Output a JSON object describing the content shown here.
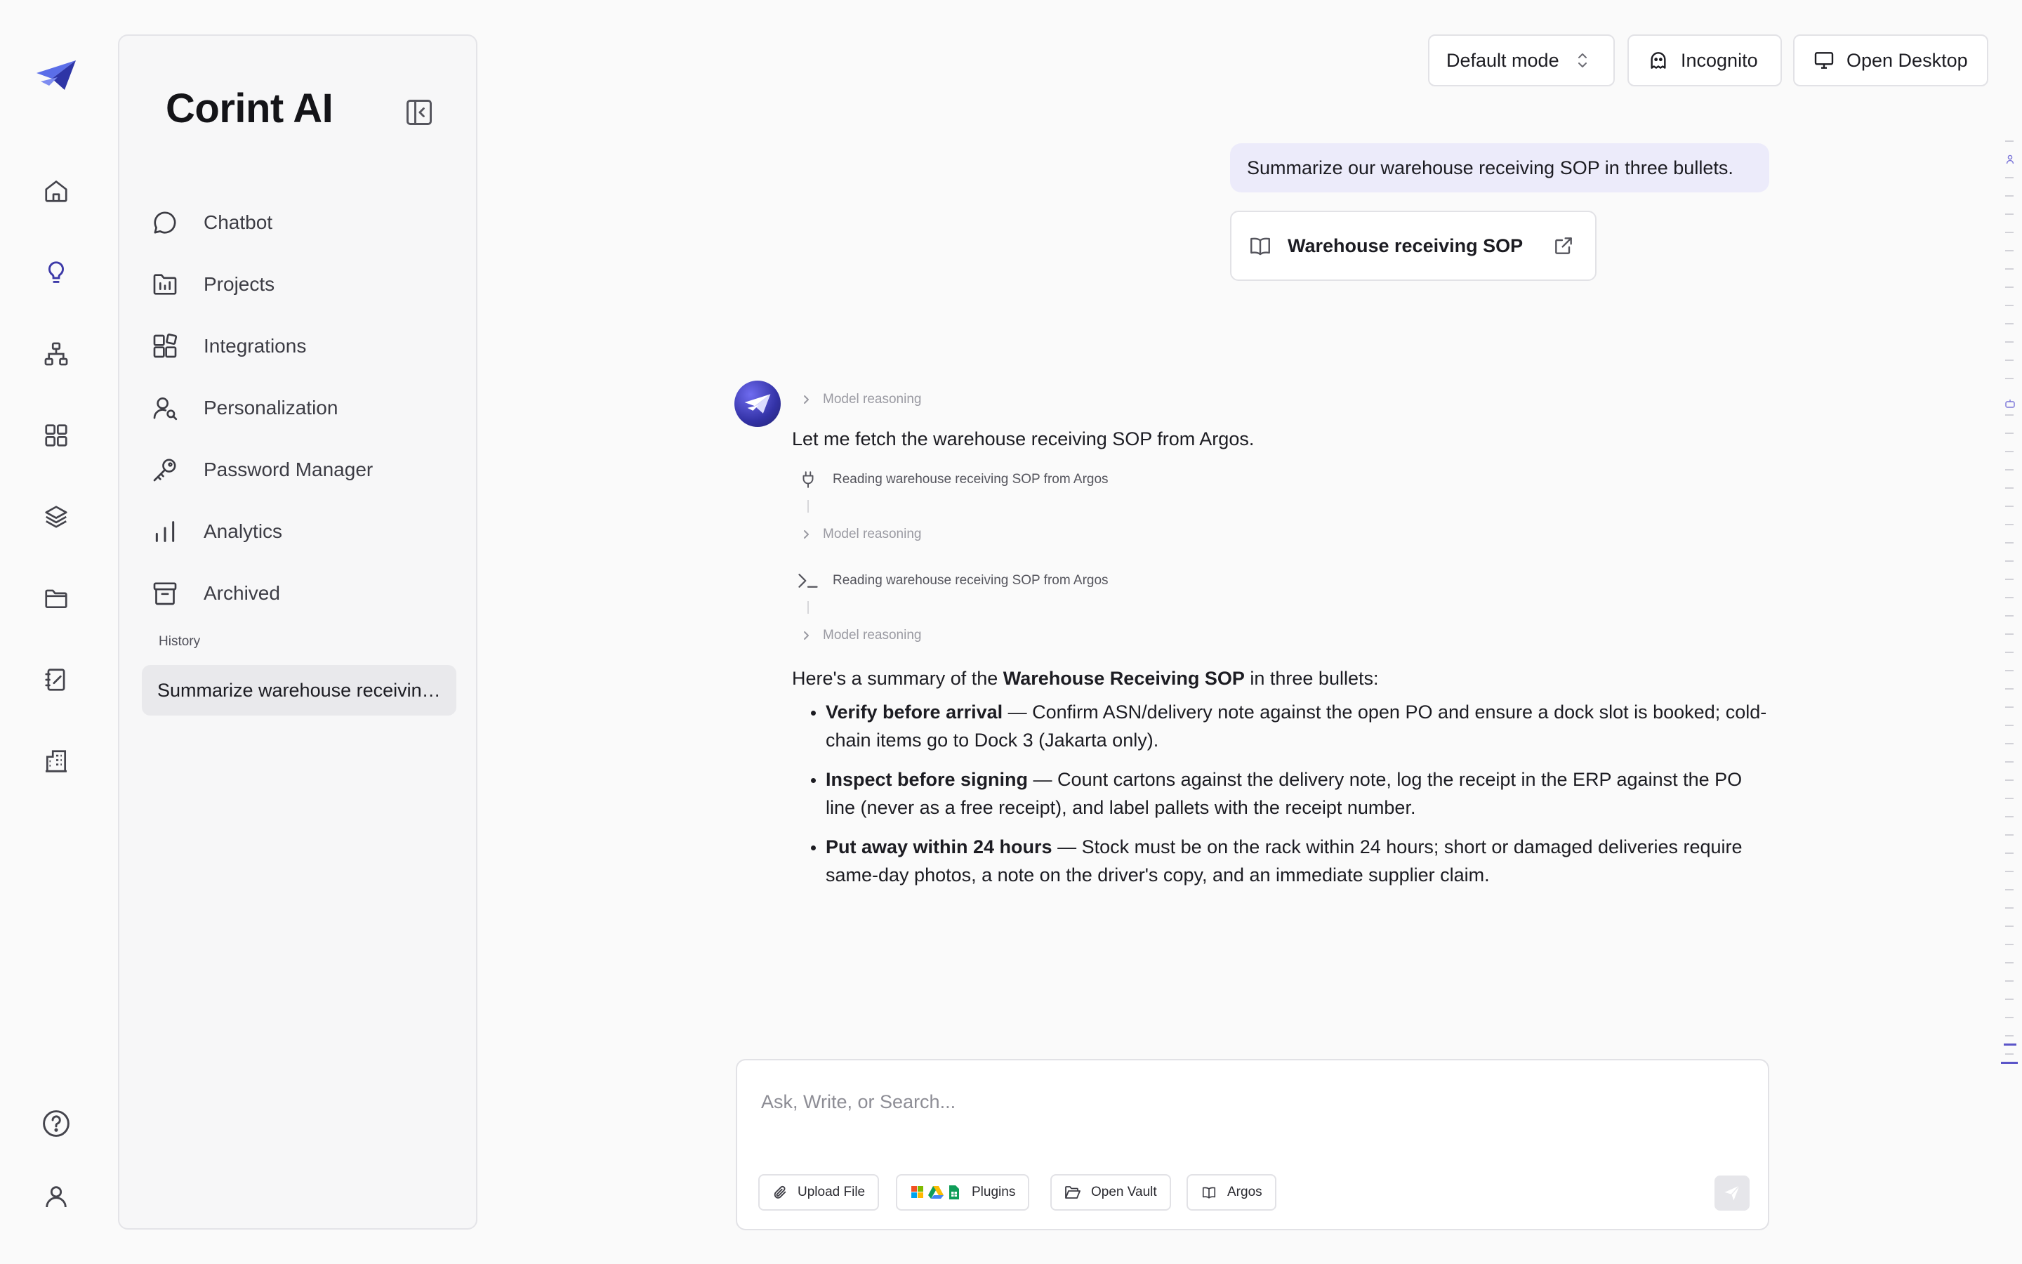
{
  "app": {
    "brand": "Corint AI"
  },
  "rail": {
    "items": [
      {
        "icon": "home-icon"
      },
      {
        "icon": "lightbulb-icon",
        "active": true
      },
      {
        "icon": "hierarchy-icon"
      },
      {
        "icon": "grid-icon"
      },
      {
        "icon": "layers-icon"
      },
      {
        "icon": "folder-icon"
      },
      {
        "icon": "notebook-icon"
      },
      {
        "icon": "building-icon"
      }
    ],
    "bottom": [
      {
        "icon": "help-icon"
      },
      {
        "icon": "user-icon"
      }
    ]
  },
  "sidebar": {
    "nav": [
      {
        "label": "Chatbot",
        "icon": "chat-bubble-icon"
      },
      {
        "label": "Projects",
        "icon": "projects-folder-icon"
      },
      {
        "label": "Integrations",
        "icon": "integrations-icon"
      },
      {
        "label": "Personalization",
        "icon": "user-search-icon"
      },
      {
        "label": "Password Manager",
        "icon": "key-icon"
      },
      {
        "label": "Analytics",
        "icon": "bar-chart-icon"
      },
      {
        "label": "Archived",
        "icon": "archive-icon"
      }
    ],
    "history_label": "History",
    "history": [
      {
        "label": "Summarize warehouse receiving SOP"
      }
    ]
  },
  "topbar": {
    "mode_label": "Default mode",
    "incognito_label": "Incognito",
    "open_desktop_label": "Open Desktop"
  },
  "conversation": {
    "user_message": "Summarize our warehouse receiving SOP in three bullets.",
    "source_card": {
      "title": "Warehouse receiving SOP"
    },
    "reasoning_label": "Model reasoning",
    "intro": "Let me fetch the warehouse receiving SOP from Argos.",
    "tool_steps": [
      {
        "label": "Reading warehouse receiving SOP from Argos",
        "icon": "plug-icon"
      },
      {
        "label": "Reading warehouse receiving SOP from Argos",
        "icon": "terminal-icon"
      }
    ],
    "answer": {
      "lead_pre": "Here's a summary of the ",
      "lead_bold": "Warehouse Receiving SOP",
      "lead_post": " in three bullets:",
      "bullets": [
        {
          "title": "Verify before arrival",
          "text": " — Confirm ASN/delivery note against the open PO and ensure a dock slot is booked; cold-chain items go to Dock 3 (Jakarta only)."
        },
        {
          "title": "Inspect before signing",
          "text": " — Count cartons against the delivery note, log the receipt in the ERP against the PO line (never as a free receipt), and label pallets with the receipt number."
        },
        {
          "title": "Put away within 24 hours",
          "text": " — Stock must be on the rack within 24 hours; short or damaged deliveries require same-day photos, a note on the driver's copy, and an immediate supplier claim."
        }
      ]
    }
  },
  "composer": {
    "placeholder": "Ask, Write, or Search...",
    "value": "",
    "chips": [
      {
        "label": "Upload File",
        "icon": "paperclip-icon"
      },
      {
        "label": "Plugins",
        "icon": "plugins-icon"
      },
      {
        "label": "Open Vault",
        "icon": "folder-open-icon"
      },
      {
        "label": "Argos",
        "icon": "book-icon"
      }
    ]
  },
  "colors": {
    "accent": "#3d3aa8",
    "user_bubble": "#ecebfa",
    "background": "#fafafa"
  }
}
